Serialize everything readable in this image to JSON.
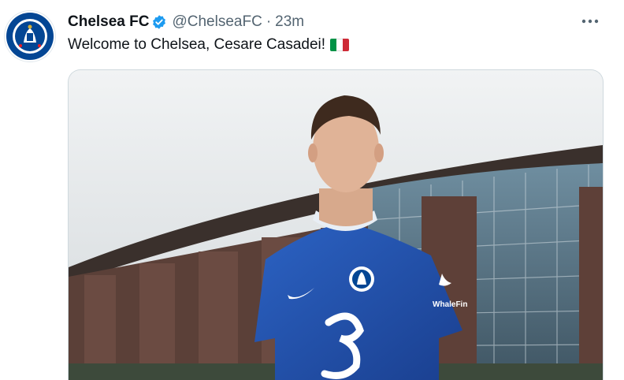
{
  "tweet": {
    "author_name": "Chelsea FC",
    "handle": "@ChelseaFC",
    "separator": "·",
    "time": "23m",
    "text": "Welcome to Chelsea, Cesare Casadei!",
    "flag_colors": [
      "#009246",
      "#ffffff",
      "#ce2b37"
    ],
    "more_icon": "more-horizontal-icon",
    "verified_icon": "verified-badge-icon"
  },
  "photo": {
    "sponsor_text": "WhaleFin"
  },
  "colors": {
    "accent": "#1d9bf0",
    "chelsea_blue": "#034694",
    "secondary_text": "#536471"
  }
}
